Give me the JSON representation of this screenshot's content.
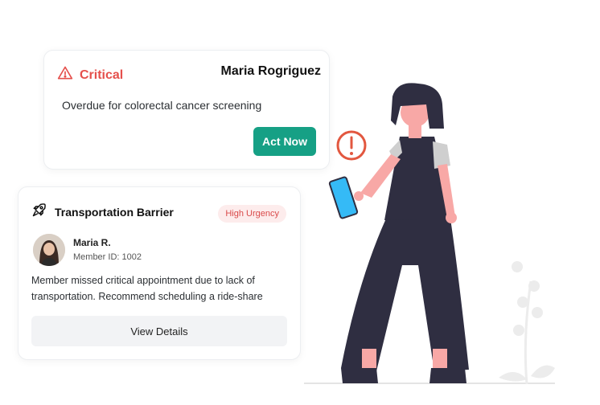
{
  "critical_card": {
    "label": "Critical",
    "patient_name": "Maria Rogriguez",
    "description": "Overdue for colorectal cancer screening",
    "button_label": "Act Now",
    "accent_color": "#e5504c",
    "button_color": "#16a085"
  },
  "transport_card": {
    "title": "Transportation Barrier",
    "badge": "High Urgency",
    "member_name": "Maria R.",
    "member_id": "Member ID: 1002",
    "description": "Member missed critical appointment due to lack of transportation. Recommend scheduling a ride-share",
    "button_label": "View Details",
    "badge_color": "#d94a4a"
  },
  "icons": [
    "alert-triangle-icon",
    "rocket-icon",
    "alert-circle-icon"
  ]
}
